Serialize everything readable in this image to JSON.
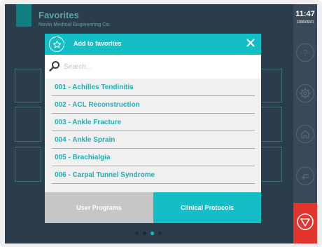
{
  "page": {
    "title": "Favorites",
    "subtitle": "Novin Medical Engineering Co."
  },
  "status": {
    "time": "11:47",
    "date": "1396/05/01"
  },
  "sidebar": {
    "icons": [
      "help-icon",
      "settings-icon",
      "home-icon",
      "back-icon"
    ],
    "stop_icon": "stop-icon"
  },
  "pagination": {
    "count": 4,
    "active_index": 2
  },
  "modal": {
    "title": "Add to favorites",
    "search_placeholder": "Search...",
    "items": [
      {
        "label": "001 - Achilles Tendinitis"
      },
      {
        "label": "002 - ACL Reconstruction"
      },
      {
        "label": "003 - Ankle Fracture"
      },
      {
        "label": "004 - Ankle Sprain"
      },
      {
        "label": "005 - Brachialgia"
      },
      {
        "label": "006 - Carpal Tunnel Syndrome"
      }
    ],
    "tabs": {
      "user_programs": "User Programs",
      "clinical_protocols": "Clinical Protocols",
      "active": "clinical_protocols"
    }
  },
  "colors": {
    "accent": "#14bec6",
    "stop": "#e5342e",
    "background": "#2b3c4b"
  }
}
